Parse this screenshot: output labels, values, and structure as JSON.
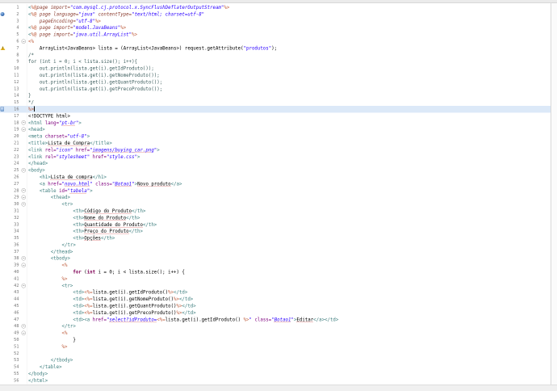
{
  "editor": {
    "file_type": "JSP source",
    "current_line": 16,
    "token_colors": {
      "tag": "#3F7F7F",
      "attribute": "#7F007F",
      "value": "#2A00FF",
      "jsp_delimiter": "#BF5F3F",
      "directive": "#8B3D30",
      "keyword": "#7F0055",
      "java": "#000000",
      "string": "#2A00FF",
      "comment": "#3F5F5F",
      "text": "#000000",
      "spellcheck_underline": "#CF3A3A",
      "current_line_bg": "#DCE9F8",
      "line_number": "#787878"
    },
    "lines": [
      {
        "num": 1,
        "tokens": [
          [
            "t",
            "<"
          ],
          [
            "d",
            "%@"
          ],
          [
            "dn",
            "page import="
          ],
          [
            "v",
            "\"com.mysql.cj.protocol.x.SyncFlushDeflaterOutputStream\""
          ],
          [
            "d",
            "%>"
          ]
        ]
      },
      {
        "num": 2,
        "ann": "breakpoint",
        "tokens": [
          [
            "t",
            "<"
          ],
          [
            "d",
            "%@"
          ],
          [
            "dn",
            " page language="
          ],
          [
            "v",
            "\"java\""
          ],
          [
            "dn",
            " contentType="
          ],
          [
            "v",
            "\"text/html; charset=utf-8\""
          ]
        ]
      },
      {
        "num": 3,
        "tokens": [
          [
            "j",
            "    "
          ],
          [
            "dn",
            "pageEncoding="
          ],
          [
            "v",
            "\"utf-8\""
          ],
          [
            "d",
            "%>"
          ]
        ]
      },
      {
        "num": 4,
        "tokens": [
          [
            "t",
            "<"
          ],
          [
            "d",
            "%@"
          ],
          [
            "dn",
            " page import="
          ],
          [
            "v",
            "\"model.JavaBeans\""
          ],
          [
            "d",
            "%>"
          ]
        ]
      },
      {
        "num": 5,
        "tokens": [
          [
            "t",
            "<"
          ],
          [
            "d",
            "%@"
          ],
          [
            "dn",
            " page import="
          ],
          [
            "v",
            "\"java.util.ArrayList\""
          ],
          [
            "d",
            "%>"
          ]
        ]
      },
      {
        "num": 6,
        "fold": true,
        "tokens": [
          [
            "d",
            "<%"
          ]
        ]
      },
      {
        "num": 7,
        "ann": "warning",
        "tokens": [
          [
            "j",
            "    ArrayList<JavaBeans> lista = (ArrayList<JavaBeans>) request.getAttribute("
          ],
          [
            "s",
            "\"produtos\""
          ],
          [
            "j",
            ");"
          ]
        ]
      },
      {
        "num": 8,
        "tokens": [
          [
            "c",
            "/*"
          ]
        ]
      },
      {
        "num": 9,
        "tokens": [
          [
            "c",
            "for (int i = 0; i < lista.size(); i++){"
          ]
        ]
      },
      {
        "num": 10,
        "tokens": [
          [
            "c",
            "    out.println(lista.get(i).getIdProduto());"
          ]
        ]
      },
      {
        "num": 11,
        "tokens": [
          [
            "c",
            "    out.println(lista.get(i).getNomeProduto());"
          ]
        ]
      },
      {
        "num": 12,
        "tokens": [
          [
            "c",
            "    out.println(lista.get(i).getQuantProduto());"
          ]
        ]
      },
      {
        "num": 13,
        "tokens": [
          [
            "c",
            "    out.println(lista.get(i).getPrecoProduto());"
          ]
        ]
      },
      {
        "num": 14,
        "tokens": [
          [
            "c",
            "}"
          ]
        ]
      },
      {
        "num": 15,
        "tokens": [
          [
            "c",
            "*/"
          ]
        ]
      },
      {
        "num": 16,
        "current": true,
        "caret": true,
        "ann": "edit-location",
        "tokens": [
          [
            "d",
            "%>"
          ]
        ]
      },
      {
        "num": 17,
        "tokens": [
          [
            "x",
            "<!DOCTYPE html>"
          ]
        ]
      },
      {
        "num": 18,
        "fold": true,
        "tokens": [
          [
            "t",
            "<html"
          ],
          [
            "a",
            " lang="
          ],
          [
            "v",
            "\""
          ],
          [
            "vu",
            "pt-br"
          ],
          [
            "v",
            "\""
          ],
          [
            "t",
            ">"
          ]
        ]
      },
      {
        "num": 19,
        "fold": true,
        "tokens": [
          [
            "t",
            "<head>"
          ]
        ]
      },
      {
        "num": 20,
        "tokens": [
          [
            "t",
            "<meta"
          ],
          [
            "a",
            " charset="
          ],
          [
            "v",
            "\"utf-8\""
          ],
          [
            "t",
            ">"
          ]
        ]
      },
      {
        "num": 21,
        "tokens": [
          [
            "t",
            "<title>"
          ],
          [
            "xu",
            "Lista de Compra"
          ],
          [
            "t",
            "</title>"
          ]
        ]
      },
      {
        "num": 22,
        "tokens": [
          [
            "t",
            "<link"
          ],
          [
            "a",
            " rel="
          ],
          [
            "v",
            "\"icon\""
          ],
          [
            "a",
            " href="
          ],
          [
            "v",
            "\""
          ],
          [
            "vu",
            "imagens/buying_car.png"
          ],
          [
            "v",
            "\""
          ],
          [
            "t",
            ">"
          ]
        ]
      },
      {
        "num": 23,
        "tokens": [
          [
            "t",
            "<link"
          ],
          [
            "a",
            " rel="
          ],
          [
            "v",
            "\"stylesheet\""
          ],
          [
            "a",
            " href="
          ],
          [
            "v",
            "\"style.css\""
          ],
          [
            "t",
            ">"
          ]
        ]
      },
      {
        "num": 24,
        "tokens": [
          [
            "t",
            "</head>"
          ]
        ]
      },
      {
        "num": 25,
        "fold": true,
        "tokens": [
          [
            "t",
            "<body>"
          ]
        ]
      },
      {
        "num": 26,
        "tokens": [
          [
            "j",
            "    "
          ],
          [
            "t",
            "<h1>"
          ],
          [
            "xu",
            "Lista de compra"
          ],
          [
            "t",
            "</h1>"
          ]
        ]
      },
      {
        "num": 27,
        "tokens": [
          [
            "j",
            "    "
          ],
          [
            "t",
            "<a"
          ],
          [
            "a",
            " href="
          ],
          [
            "v",
            "\""
          ],
          [
            "vu",
            "novo.html"
          ],
          [
            "v",
            "\""
          ],
          [
            "a",
            " class="
          ],
          [
            "v",
            "\""
          ],
          [
            "vu",
            "Botao1"
          ],
          [
            "v",
            "\""
          ],
          [
            "t",
            ">"
          ],
          [
            "xu",
            "Novo produto"
          ],
          [
            "t",
            "</a>"
          ]
        ]
      },
      {
        "num": 28,
        "fold": true,
        "tokens": [
          [
            "j",
            "    "
          ],
          [
            "t",
            "<table"
          ],
          [
            "a",
            " id="
          ],
          [
            "v",
            "\""
          ],
          [
            "vu",
            "tabela"
          ],
          [
            "v",
            "\""
          ],
          [
            "t",
            ">"
          ]
        ]
      },
      {
        "num": 29,
        "fold": true,
        "tokens": [
          [
            "j",
            "        "
          ],
          [
            "t",
            "<thead>"
          ]
        ]
      },
      {
        "num": 30,
        "fold": true,
        "tokens": [
          [
            "j",
            "            "
          ],
          [
            "t",
            "<tr>"
          ]
        ]
      },
      {
        "num": 31,
        "tokens": [
          [
            "j",
            "                "
          ],
          [
            "t",
            "<th>"
          ],
          [
            "xu",
            "Código do Produto"
          ],
          [
            "t",
            "</th>"
          ]
        ]
      },
      {
        "num": 32,
        "tokens": [
          [
            "j",
            "                "
          ],
          [
            "t",
            "<th>"
          ],
          [
            "xu",
            "Nome do Produto"
          ],
          [
            "t",
            "</th>"
          ]
        ]
      },
      {
        "num": 33,
        "tokens": [
          [
            "j",
            "                "
          ],
          [
            "t",
            "<th>"
          ],
          [
            "xu",
            "Quantidade do Produto"
          ],
          [
            "t",
            "</th>"
          ]
        ]
      },
      {
        "num": 34,
        "tokens": [
          [
            "j",
            "                "
          ],
          [
            "t",
            "<th>"
          ],
          [
            "xu",
            "Preço do Produto"
          ],
          [
            "t",
            "</th>"
          ]
        ]
      },
      {
        "num": 35,
        "tokens": [
          [
            "j",
            "                "
          ],
          [
            "t",
            "<th>"
          ],
          [
            "xu",
            "Opções"
          ],
          [
            "t",
            "</th>"
          ]
        ]
      },
      {
        "num": 36,
        "tokens": [
          [
            "j",
            "            "
          ],
          [
            "t",
            "</tr>"
          ]
        ]
      },
      {
        "num": 37,
        "tokens": [
          [
            "j",
            "        "
          ],
          [
            "t",
            "</thead>"
          ]
        ]
      },
      {
        "num": 38,
        "fold": true,
        "tokens": [
          [
            "j",
            "        "
          ],
          [
            "t",
            "<tbody>"
          ]
        ]
      },
      {
        "num": 39,
        "fold": true,
        "tokens": [
          [
            "j",
            "            "
          ],
          [
            "d",
            "<%"
          ]
        ]
      },
      {
        "num": 40,
        "tokens": [
          [
            "j",
            "                "
          ],
          [
            "k",
            "for"
          ],
          [
            "j",
            " ("
          ],
          [
            "k",
            "int"
          ],
          [
            "j",
            " i = 0; i < lista.size(); i++) {"
          ]
        ]
      },
      {
        "num": 41,
        "tokens": [
          [
            "j",
            "            "
          ],
          [
            "d",
            "%>"
          ]
        ]
      },
      {
        "num": 42,
        "fold": true,
        "tokens": [
          [
            "j",
            "            "
          ],
          [
            "t",
            "<tr>"
          ]
        ]
      },
      {
        "num": 43,
        "tokens": [
          [
            "j",
            "                "
          ],
          [
            "t",
            "<td>"
          ],
          [
            "d",
            "<%="
          ],
          [
            "j",
            "lista.get(i).getIdProduto()"
          ],
          [
            "d",
            "%>"
          ],
          [
            "t",
            "</td>"
          ]
        ]
      },
      {
        "num": 44,
        "tokens": [
          [
            "j",
            "                "
          ],
          [
            "t",
            "<td>"
          ],
          [
            "d",
            "<%="
          ],
          [
            "j",
            "lista.get(i).getNomeProduto()"
          ],
          [
            "d",
            "%>"
          ],
          [
            "t",
            "</td>"
          ]
        ]
      },
      {
        "num": 45,
        "tokens": [
          [
            "j",
            "                "
          ],
          [
            "t",
            "<td>"
          ],
          [
            "d",
            "<%="
          ],
          [
            "j",
            "lista.get(i).getQuantProduto()"
          ],
          [
            "d",
            "%>"
          ],
          [
            "t",
            "</td>"
          ]
        ]
      },
      {
        "num": 46,
        "tokens": [
          [
            "j",
            "                "
          ],
          [
            "t",
            "<td>"
          ],
          [
            "d",
            "<%="
          ],
          [
            "j",
            "lista.get(i).getPrecoProduto()"
          ],
          [
            "d",
            "%>"
          ],
          [
            "t",
            "</td>"
          ]
        ]
      },
      {
        "num": 47,
        "tokens": [
          [
            "j",
            "                "
          ],
          [
            "t",
            "<td>"
          ],
          [
            "t",
            "<a"
          ],
          [
            "a",
            " href="
          ],
          [
            "v",
            "\""
          ],
          [
            "vu",
            "select?idProduto="
          ],
          [
            "d",
            "<%="
          ],
          [
            "j",
            "lista.get(i).getIdProduto() "
          ],
          [
            "d",
            "%>"
          ],
          [
            "v",
            "\""
          ],
          [
            "a",
            " class="
          ],
          [
            "v",
            "\""
          ],
          [
            "vu",
            "Botao1"
          ],
          [
            "v",
            "\""
          ],
          [
            "t",
            ">"
          ],
          [
            "xu",
            "Editar"
          ],
          [
            "t",
            "</a>"
          ],
          [
            "t",
            "</td>"
          ]
        ]
      },
      {
        "num": 48,
        "fold": true,
        "tokens": [
          [
            "j",
            "            "
          ],
          [
            "t",
            "</tr>"
          ]
        ]
      },
      {
        "num": 49,
        "fold": true,
        "tokens": [
          [
            "j",
            "            "
          ],
          [
            "d",
            "<%"
          ]
        ]
      },
      {
        "num": 50,
        "tokens": [
          [
            "j",
            "                }"
          ]
        ]
      },
      {
        "num": 51,
        "tokens": [
          [
            "j",
            "            "
          ],
          [
            "d",
            "%>"
          ]
        ]
      },
      {
        "num": 52,
        "tokens": []
      },
      {
        "num": 53,
        "tokens": [
          [
            "j",
            "        "
          ],
          [
            "t",
            "</tbody>"
          ]
        ]
      },
      {
        "num": 54,
        "tokens": [
          [
            "j",
            "    "
          ],
          [
            "t",
            "</table>"
          ]
        ]
      },
      {
        "num": 55,
        "tokens": [
          [
            "t",
            "</body>"
          ]
        ]
      },
      {
        "num": 56,
        "tokens": [
          [
            "t",
            "</html>"
          ]
        ]
      }
    ]
  }
}
